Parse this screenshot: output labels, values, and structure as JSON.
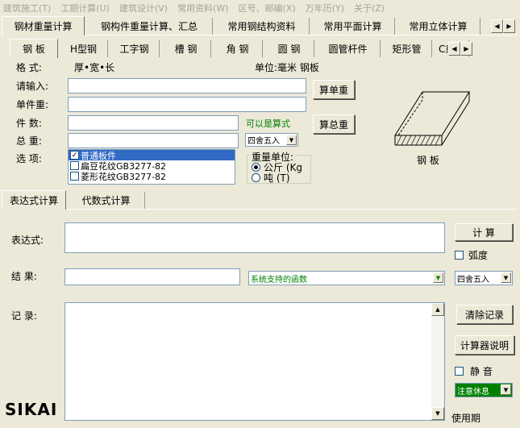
{
  "menu": [
    "建筑施工(T)",
    "工期计算(U)",
    "建筑设计(V)",
    "常用资料(W)",
    "区号、邮编(X)",
    "万年历(Y)",
    "关于(Z)"
  ],
  "main_tabs": [
    "钢材重量计算",
    "钢构件重量计算、汇总",
    "常用钢结构资料",
    "常用平面计算",
    "常用立体计算"
  ],
  "sub_tabs": [
    "钢 板",
    "H型钢",
    "工字钢",
    "槽 钢",
    "角 钢",
    "圆 钢",
    "圆管杆件",
    "矩形管",
    "C或Z"
  ],
  "form": {
    "format_label": "格 式:",
    "format_value": "厚•宽•长",
    "unit_text": "单位:毫米 钢板",
    "input_label": "请输入:",
    "unit_weight_label": "单件重:",
    "count_label": "件 数:",
    "total_label": "总 重:",
    "options_label": "选 项:",
    "calc_unit_button": "算单重",
    "calc_total_button": "算总重",
    "expr_hint": "可以是算式",
    "rounding_select": "四舍五入",
    "options": [
      {
        "label": "普通板件",
        "checked": true,
        "selected": true
      },
      {
        "label": "扁豆花纹GB3277-82",
        "checked": false,
        "selected": false
      },
      {
        "label": "菱形花纹GB3277-82",
        "checked": false,
        "selected": false
      }
    ],
    "weight_unit_title": "重量单位:",
    "weight_units": [
      {
        "label": "公斤 (Kg",
        "selected": true
      },
      {
        "label": "吨  (T)",
        "selected": false
      }
    ],
    "diagram_label": "钢 板"
  },
  "calc": {
    "tabs": [
      "表达式计算",
      "代数式计算"
    ],
    "expr_label": "表达式:",
    "result_label": "结 果:",
    "record_label": "记 录:",
    "calc_button": "计 算",
    "radian_label": "弧度",
    "func_select": "系统支持的函数",
    "rounding_select": "四舍五入",
    "clear_button": "清除记录",
    "help_button": "计算器说明",
    "mute_label": "静 音",
    "rest_select": "注意休息",
    "usage_label": "使用期",
    "logo": "SIKAI"
  },
  "colors": {
    "background": "#ece9d8",
    "selection": "#316ac5",
    "hint_green": "#008000",
    "rest_bg": "#008000"
  }
}
